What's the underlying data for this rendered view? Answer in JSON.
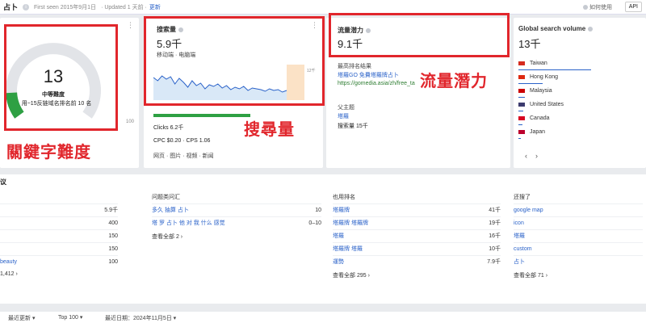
{
  "topbar": {
    "title": "占卜",
    "first_seen": "First seen 2015年9月1日",
    "updated": "· Updated 1 天前 ·",
    "update_link": "更新",
    "help": "如何使用",
    "api": "API"
  },
  "difficulty": {
    "value": "13",
    "label": "中等難度",
    "sub": "用~15反链域名排名前 10 名",
    "fill_fraction": 0.13,
    "axis_max": "100"
  },
  "volume": {
    "title": "搜索量",
    "value": "5.9千",
    "subtitle": "移动端 · 电脑端",
    "chart_max": "12千",
    "clicks": "Clicks 6.2千",
    "cpc": "CPC $0.20 · CPS 1.06",
    "serp_features": "网页 · 图片 · 视频 · 新闻"
  },
  "traffic": {
    "title": "流量潜力",
    "value": "9.1千",
    "top_result_label": "最高排名结果",
    "top_result_title": "塔羅GO 免費塔羅牌占卜",
    "top_result_url": "https://gomedia.asia/zh/free_ta",
    "parent_label": "父主题",
    "parent_topic": "塔羅",
    "parent_volume": "搜索量 15千"
  },
  "global": {
    "title": "Global search volume",
    "value": "13千",
    "countries": [
      {
        "name": "Taiwan",
        "share": 0.6
      },
      {
        "name": "Hong Kong",
        "share": 0.2
      },
      {
        "name": "Malaysia",
        "share": 0.05
      },
      {
        "name": "United States",
        "share": 0.04
      },
      {
        "name": "Canada",
        "share": 0.03
      },
      {
        "name": "Japan",
        "share": 0.02
      }
    ]
  },
  "overlays": {
    "difficulty": "關鍵字難度",
    "volume": "搜尋量",
    "traffic": "流量潛力"
  },
  "ideas": {
    "header_left": "议",
    "col1": {
      "rows": [
        {
          "term": "",
          "value": "5.9千"
        },
        {
          "term": "",
          "value": "400"
        },
        {
          "term": "",
          "value": "150"
        },
        {
          "term": "",
          "value": "150"
        },
        {
          "term": "beauty",
          "value": "100"
        }
      ],
      "more": "1,412"
    },
    "col2": {
      "header": "问题类问汇",
      "rows": [
        {
          "term": "多久 抽算 占卜",
          "value": "10"
        },
        {
          "term": "塔 罗 占卜 他 对 我 什么 感觉",
          "value": "0–10"
        }
      ],
      "more": "查看全部 2"
    },
    "col3": {
      "header": "也用排名",
      "rows": [
        {
          "term": "塔羅牌",
          "value": "41千"
        },
        {
          "term": "塔羅牌 塔羅牌",
          "value": "19千"
        },
        {
          "term": "塔羅",
          "value": "16千"
        },
        {
          "term": "塔羅牌 塔羅",
          "value": "10千"
        },
        {
          "term": "運勢",
          "value": "7.9千"
        }
      ],
      "more": "查看全部 295"
    },
    "col4": {
      "header": "还搜了",
      "rows": [
        {
          "term": "google map"
        },
        {
          "term": "icon"
        },
        {
          "term": "塔羅"
        },
        {
          "term": "custom"
        },
        {
          "term": "占卜"
        }
      ],
      "more": "查看全部 71"
    }
  },
  "footer": {
    "item1": "最近更新",
    "item2": "Top 100",
    "item3": "最近日期：2024年11月5日"
  }
}
